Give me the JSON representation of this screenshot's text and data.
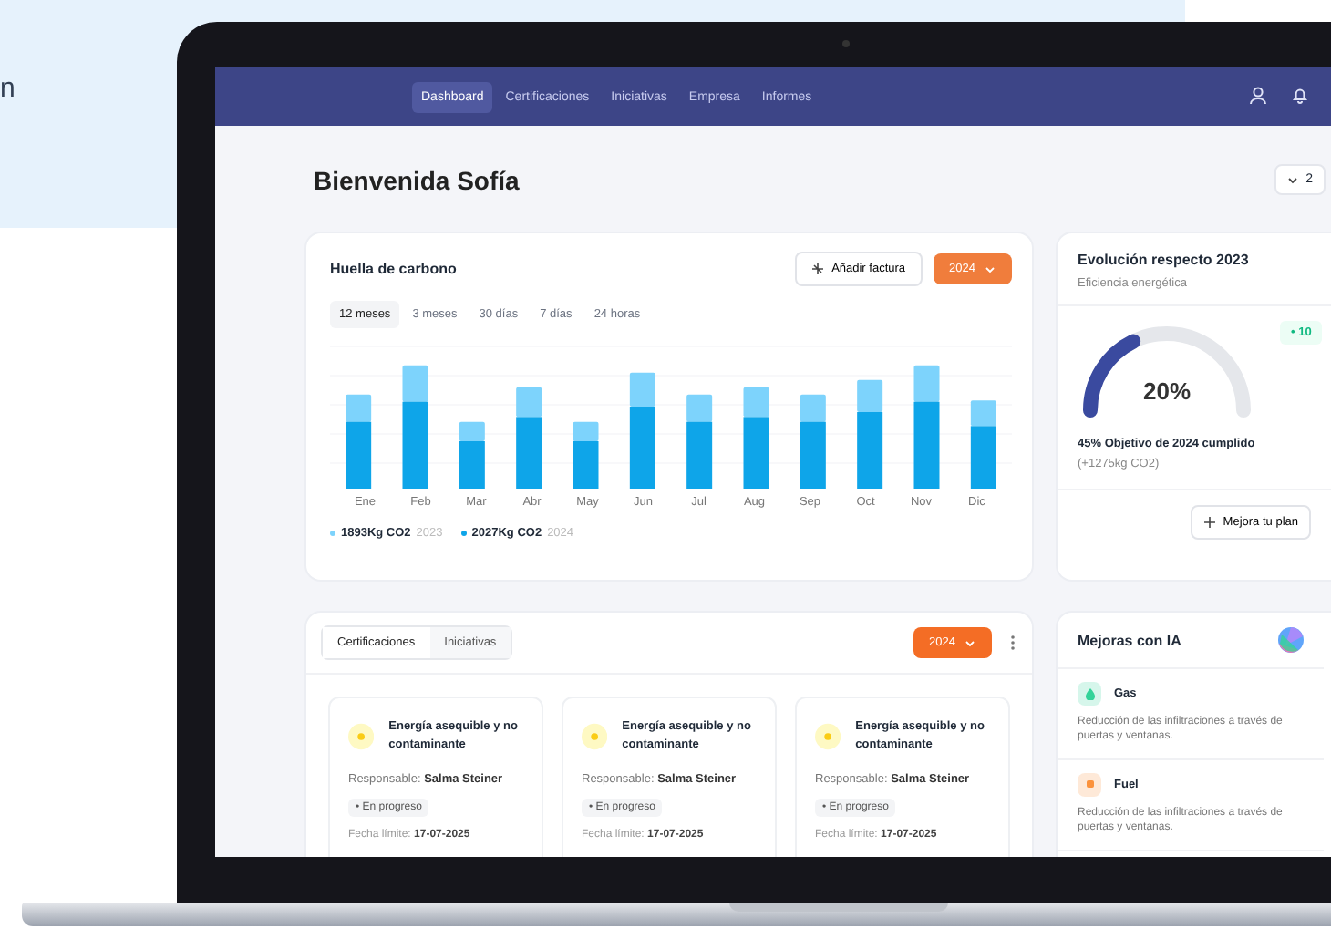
{
  "background_text": "n",
  "nav": {
    "tabs": [
      {
        "label": "Dashboard",
        "selected": true
      },
      {
        "label": "Certificaciones",
        "selected": false
      },
      {
        "label": "Iniciativas",
        "selected": false
      },
      {
        "label": "Empresa",
        "selected": false
      },
      {
        "label": "Informes",
        "selected": false
      }
    ]
  },
  "header": {
    "title": "Bienvenida Sofía",
    "dropdown": "2"
  },
  "carbon": {
    "title": "Huella de carbono",
    "add_button": "Añadir factura",
    "year": "2024",
    "periods": [
      {
        "label": "12 meses",
        "selected": true
      },
      {
        "label": "3 meses",
        "selected": false
      },
      {
        "label": "30 días",
        "selected": false
      },
      {
        "label": "7 días",
        "selected": false
      },
      {
        "label": "24 horas",
        "selected": false
      }
    ],
    "months": [
      "Ene",
      "Feb",
      "Mar",
      "Abr",
      "May",
      "Jun",
      "Jul",
      "Aug",
      "Sep",
      "Oct",
      "Nov",
      "Dic"
    ],
    "legend": [
      {
        "value": "1893Kg CO2",
        "year": "2023",
        "color": "#7dd3fc"
      },
      {
        "value": "2027Kg CO2",
        "year": "2024",
        "color": "#0ea5e9"
      }
    ]
  },
  "evolution": {
    "title": "Evolución respecto 2023",
    "subtitle": "Eficiencia energética",
    "gauge": {
      "level": 0.3,
      "reading": "20%"
    },
    "badge": "• 10",
    "goal": "45% Objetivo de 2024 cumplido",
    "goal_note": "(+1275kg CO2)",
    "button": "Mejora tu plan"
  },
  "initiatives": {
    "tabs": [
      {
        "label": "Certificaciones",
        "selected": true
      },
      {
        "label": "Iniciativas",
        "selected": false
      }
    ],
    "year": "2024",
    "cards": [
      {
        "title": "Energía asequible y no contaminante",
        "owner": "Responsable: **Salma Steiner**",
        "status": "• En progreso",
        "deadline": "Fecha límite: **17-07-2025**"
      },
      {
        "title": "Energía asequible y no contaminante",
        "owner": "Responsable: **Salma Steiner**",
        "status": "• En progreso",
        "deadline": "Fecha límite: **17-07-2025**"
      },
      {
        "title": "Energía asequible y no contaminante",
        "owner": "Responsable: **Salma Steiner**",
        "status": "• En progreso",
        "deadline": "Fecha límite: **17-07-2025**"
      }
    ]
  },
  "ai": {
    "title": "Mejoras con IA",
    "items": [
      {
        "kind": "gas",
        "name": "Gas",
        "color": "#34d399",
        "description": "Reducción de las infiltraciones a través de puertas y ventanas."
      },
      {
        "kind": "fuel",
        "name": "Fuel",
        "color": "#fb923c",
        "description": "Reducción de las infiltraciones a través de puertas y ventanas."
      }
    ]
  }
}
